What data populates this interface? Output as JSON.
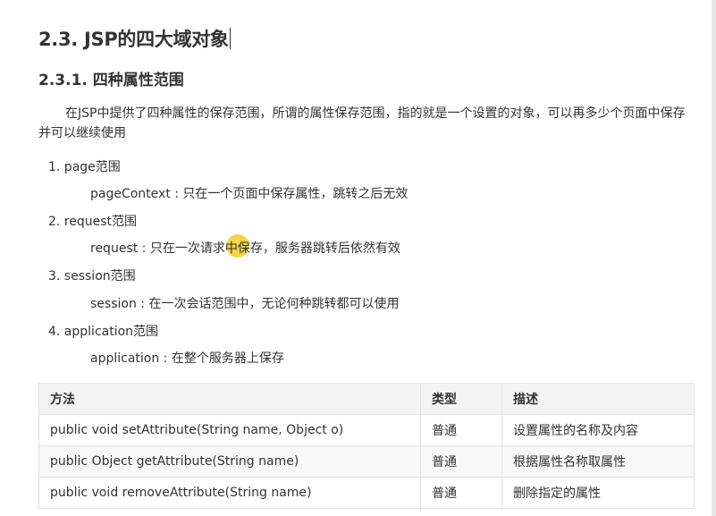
{
  "heading": {
    "title": "2.3. JSP的四大域对象",
    "subtitle": "2.3.1. 四种属性范围"
  },
  "intro": "在JSP中提供了四种属性的保存范围，所谓的属性保存范围，指的就是一个设置的对象，可以再多少个页面中保存并可以继续使用",
  "scopes": [
    {
      "title": "1. page范围",
      "desc": "pageContext : 只在一个页面中保存属性，跳转之后无效"
    },
    {
      "title": "2. request范围",
      "desc": "request : 只在一次请求中保存，服务器跳转后依然有效"
    },
    {
      "title": "3. session范围",
      "desc": "session : 在一次会话范围中，无论何种跳转都可以使用"
    },
    {
      "title": "4. application范围",
      "desc": "application : 在整个服务器上保存"
    }
  ],
  "table": {
    "headers": [
      "方法",
      "类型",
      "描述"
    ],
    "rows": [
      [
        "public void setAttribute(String name, Object o)",
        "普通",
        "设置属性的名称及内容"
      ],
      [
        "public Object getAttribute(String name)",
        "普通",
        "根据属性名称取属性"
      ],
      [
        "public void removeAttribute(String name)",
        "普通",
        "删除指定的属性"
      ]
    ]
  },
  "colors": {
    "text": "#333333",
    "table_border": "#dfe2e5",
    "table_header_bg": "#f3f3f3",
    "highlight": "#f0cd28"
  }
}
